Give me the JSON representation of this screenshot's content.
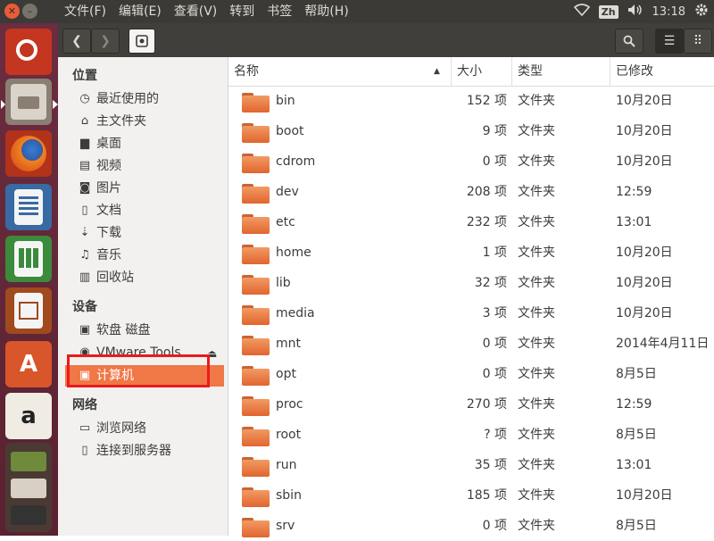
{
  "menubar": {
    "close_glyph": "✕",
    "minimize_glyph": "–",
    "menus": [
      "文件(F)",
      "编辑(E)",
      "查看(V)",
      "转到",
      "书签",
      "帮助(H)"
    ],
    "ime": "Zh",
    "clock": "13:18",
    "icons": [
      "wifi-icon",
      "volume-icon",
      "settings-gear-icon"
    ]
  },
  "launcher": {
    "items": [
      "ubuntu-dash",
      "files",
      "firefox",
      "libreoffice-writer",
      "libreoffice-calc",
      "libreoffice-impress",
      "ubuntu-software",
      "amazon",
      "more-apps"
    ],
    "amazon_glyph": "a",
    "store_glyph": "A"
  },
  "toolbar": {
    "back_glyph": "❮",
    "forward_glyph": "❯",
    "search_glyph": "⚲",
    "list_glyph": "☰",
    "grid_glyph": "⠿",
    "location": "computer"
  },
  "sidebar": {
    "places_heading": "位置",
    "places": [
      {
        "label": "最近使用的",
        "icon": "◷"
      },
      {
        "label": "主文件夹",
        "icon": "⌂"
      },
      {
        "label": "桌面",
        "icon": "▆"
      },
      {
        "label": "视频",
        "icon": "▤"
      },
      {
        "label": "图片",
        "icon": "◙"
      },
      {
        "label": "文档",
        "icon": "▯"
      },
      {
        "label": "下载",
        "icon": "⇣"
      },
      {
        "label": "音乐",
        "icon": "♫"
      },
      {
        "label": "回收站",
        "icon": "▥"
      }
    ],
    "devices_heading": "设备",
    "devices": [
      {
        "label": "软盘 磁盘",
        "icon": "▣"
      },
      {
        "label": "VMware Tools",
        "icon": "◉"
      },
      {
        "label": "计算机",
        "icon": "▣"
      }
    ],
    "eject_glyph": "⏏",
    "network_heading": "网络",
    "network": [
      {
        "label": "浏览网络",
        "icon": "▭"
      },
      {
        "label": "连接到服务器",
        "icon": "▯"
      }
    ]
  },
  "columns": {
    "name": "名称",
    "sort_glyph": "▲",
    "size": "大小",
    "type": "类型",
    "modified": "已修改"
  },
  "files": [
    {
      "name": "bin",
      "size": "152 项",
      "type": "文件夹",
      "modified": "10月20日"
    },
    {
      "name": "boot",
      "size": "9 项",
      "type": "文件夹",
      "modified": "10月20日"
    },
    {
      "name": "cdrom",
      "size": "0 项",
      "type": "文件夹",
      "modified": "10月20日"
    },
    {
      "name": "dev",
      "size": "208 项",
      "type": "文件夹",
      "modified": "12:59"
    },
    {
      "name": "etc",
      "size": "232 项",
      "type": "文件夹",
      "modified": "13:01"
    },
    {
      "name": "home",
      "size": "1 项",
      "type": "文件夹",
      "modified": "10月20日"
    },
    {
      "name": "lib",
      "size": "32 项",
      "type": "文件夹",
      "modified": "10月20日"
    },
    {
      "name": "media",
      "size": "3 项",
      "type": "文件夹",
      "modified": "10月20日"
    },
    {
      "name": "mnt",
      "size": "0 项",
      "type": "文件夹",
      "modified": "2014年4月11日"
    },
    {
      "name": "opt",
      "size": "0 项",
      "type": "文件夹",
      "modified": "8月5日"
    },
    {
      "name": "proc",
      "size": "270 项",
      "type": "文件夹",
      "modified": "12:59"
    },
    {
      "name": "root",
      "size": "? 项",
      "type": "文件夹",
      "modified": "8月5日"
    },
    {
      "name": "run",
      "size": "35 项",
      "type": "文件夹",
      "modified": "13:01"
    },
    {
      "name": "sbin",
      "size": "185 项",
      "type": "文件夹",
      "modified": "10月20日"
    },
    {
      "name": "srv",
      "size": "0 项",
      "type": "文件夹",
      "modified": "8月5日"
    }
  ],
  "colors": {
    "accent": "#f07746",
    "highlight_box": "#e81c1c",
    "folder": "#e8743a",
    "titlebar": "#3b3a36"
  }
}
